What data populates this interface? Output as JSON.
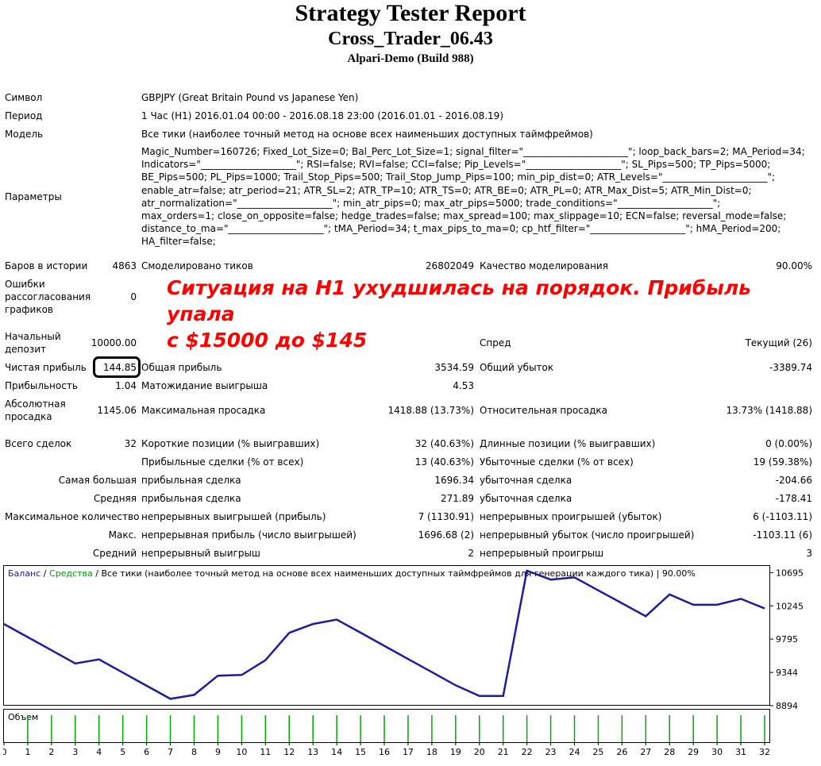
{
  "header": {
    "title": "Strategy Tester Report",
    "subtitle": "Cross_Trader_06.43",
    "build": "Alpari-Demo (Build 988)"
  },
  "info": {
    "symbol_label": "Символ",
    "symbol_value": "GBPJPY (Great Britain Pound vs Japanese Yen)",
    "period_label": "Период",
    "period_value": "1 Час (H1) 2016.01.04 00:00 - 2016.08.18 23:00 (2016.01.01 - 2016.08.19)",
    "model_label": "Модель",
    "model_value": "Все тики (наиболее точный метод на основе всех наименьших доступных таймфреймов)",
    "params_label": "Параметры",
    "params_lines": [
      "Magic_Number=160726; Fixed_Lot_Size=0; Bal_Perc_Lot_Size=1; signal_filter=\"______________________\"; loop_back_bars=2; MA_Period=34;",
      "Indicators=\"____________________\"; RSI=false; RVI=false; CCI=false; Pip_Levels=\"____________________\"; SL_Pips=500; TP_Pips=5000;",
      "BE_Pips=500; PL_Pips=1000; Trail_Stop_Pips=500; Trail_Stop_Jump_Pips=100; min_pip_dist=0; ATR_Levels=\"______________________\";",
      "enable_atr=false; atr_period=21; ATR_SL=2; ATR_TP=10; ATR_TS=0; ATR_BE=0; ATR_PL=0; ATR_Max_Dist=5; ATR_Min_Dist=0;",
      "atr_normalization=\"____________________\"; min_atr_pips=0; max_atr_pips=5000; trade_conditions=\"____________________\";",
      "max_orders=1; close_on_opposite=false; hedge_trades=false; max_spread=100; max_slippage=10; ECN=false; reversal_mode=false;",
      "distance_to_ma=\"____________________\"; tMA_Period=34; t_max_pips_to_ma=0; cp_htf_filter=\"____________________\"; hMA_Period=200;",
      "HA_filter=false;"
    ]
  },
  "stats": {
    "bars_label": "Баров в истории",
    "bars_value": "4863",
    "ticks_label": "Смоделировано тиков",
    "ticks_value": "26802049",
    "quality_label": "Качество моделирования",
    "quality_value": "90.00%",
    "errors_label": "Ошибки рассогласования графиков",
    "errors_value": "0",
    "deposit_label": "Начальный депозит",
    "deposit_value": "10000.00",
    "spread_label": "Спред",
    "spread_value": "Текущий (26)",
    "net_label": "Чистая прибыль",
    "net_value": "144.85",
    "gross_profit_label": "Общая прибыль",
    "gross_profit_value": "3534.59",
    "gross_loss_label": "Общий убыток",
    "gross_loss_value": "-3389.74",
    "pf_label": "Прибыльность",
    "pf_value": "1.04",
    "expected_label": "Матожидание выигрыша",
    "expected_value": "4.53",
    "abs_dd_label": "Абсолютная просадка",
    "abs_dd_value": "1145.06",
    "max_dd_label": "Максимальная просадка",
    "max_dd_value": "1418.88 (13.73%)",
    "rel_dd_label": "Относительная просадка",
    "rel_dd_value": "13.73% (1418.88)",
    "total_label": "Всего сделок",
    "total_value": "32",
    "short_label": "Короткие позиции (% выигравших)",
    "short_value": "32 (40.63%)",
    "long_label": "Длинные позиции (% выигравших)",
    "long_value": "0 (0.00%)",
    "profit_trades_label": "Прибыльные сделки (% от всех)",
    "profit_trades_value": "13 (40.63%)",
    "loss_trades_label": "Убыточные сделки (% от всех)",
    "loss_trades_value": "19 (59.38%)",
    "largest_label": "Самая большая",
    "largest_profit_label": "прибыльная сделка",
    "largest_profit_value": "1696.34",
    "largest_loss_label": "убыточная сделка",
    "largest_loss_value": "-204.66",
    "average_label": "Средняя",
    "average_profit_label": "прибыльная сделка",
    "average_profit_value": "271.89",
    "average_loss_label": "убыточная сделка",
    "average_loss_value": "-178.41",
    "maxcount_label": "Максимальное количество",
    "maxcount_wins_label": "непрерывных выигрышей (прибыль)",
    "maxcount_wins_value": "7 (1130.91)",
    "maxcount_losses_label": "непрерывных проигрышей (убыток)",
    "maxcount_losses_value": "6 (-1103.11)",
    "max_label": "Макс.",
    "max_profit_label": "непрерывная прибыль (число выигрышей)",
    "max_profit_value": "1696.68 (2)",
    "max_loss_label": "непрерывный убыток (число проигрышей)",
    "max_loss_value": "-1103.11 (6)",
    "avg_label": "Средний",
    "avg_win_label": "непрерывный выигрыш",
    "avg_win_value": "2",
    "avg_loss_label": "непрерывный проигрыш",
    "avg_loss_value": "3"
  },
  "annotation": {
    "line1": "Ситуация на H1 ухудшилась на порядок. Прибыль упала",
    "line2": "с $15000 до $145"
  },
  "chart_data": {
    "type": "line",
    "legend": {
      "balance": "Баланс",
      "sep1": " / ",
      "equity": "Средства",
      "sep2": " / ",
      "rest": "Все тики (наиболее точный метод на основе всех наименьших доступных таймфреймов для генерации каждого тика) | 90.00%"
    },
    "volume_label": "Объем",
    "y_ticks": [
      10695,
      10245,
      9795,
      9344,
      8894
    ],
    "ylim": [
      8894,
      10785
    ],
    "x_ticks": [
      0,
      1,
      2,
      3,
      4,
      5,
      6,
      7,
      8,
      9,
      10,
      11,
      12,
      13,
      14,
      15,
      16,
      17,
      18,
      19,
      20,
      21,
      22,
      23,
      24,
      25,
      26,
      27,
      28,
      29,
      30,
      31,
      32
    ],
    "xlim": [
      0,
      32.2
    ],
    "balance": {
      "x": [
        0,
        1,
        2,
        3,
        4,
        5,
        6,
        7,
        8,
        9,
        10,
        11,
        12,
        13,
        14,
        15,
        16,
        17,
        18,
        19,
        20,
        21,
        22,
        23,
        24,
        25,
        26,
        27,
        28,
        29,
        30,
        31,
        32
      ],
      "y": [
        10000,
        9822,
        9644,
        9466,
        9520,
        9342,
        9164,
        8986,
        9040,
        9300,
        9310,
        9510,
        9880,
        10000,
        10060,
        9882,
        9704,
        9526,
        9348,
        9170,
        9025,
        9025,
        10720,
        10600,
        10630,
        10455,
        10280,
        10105,
        10400,
        10260,
        10260,
        10340,
        10210
      ]
    },
    "volume_x": [
      1,
      2,
      3,
      4,
      5,
      6,
      7,
      8,
      9,
      10,
      11,
      12,
      13,
      14,
      15,
      16,
      17,
      18,
      19,
      20,
      21,
      22,
      23,
      24,
      25,
      26,
      27,
      28,
      29,
      30,
      31,
      32
    ]
  },
  "colors": {
    "balance_line": "#1c1c9c",
    "equity_text": "#00a000",
    "volume_bar": "#00aa00",
    "annotation": "#ff0000"
  }
}
